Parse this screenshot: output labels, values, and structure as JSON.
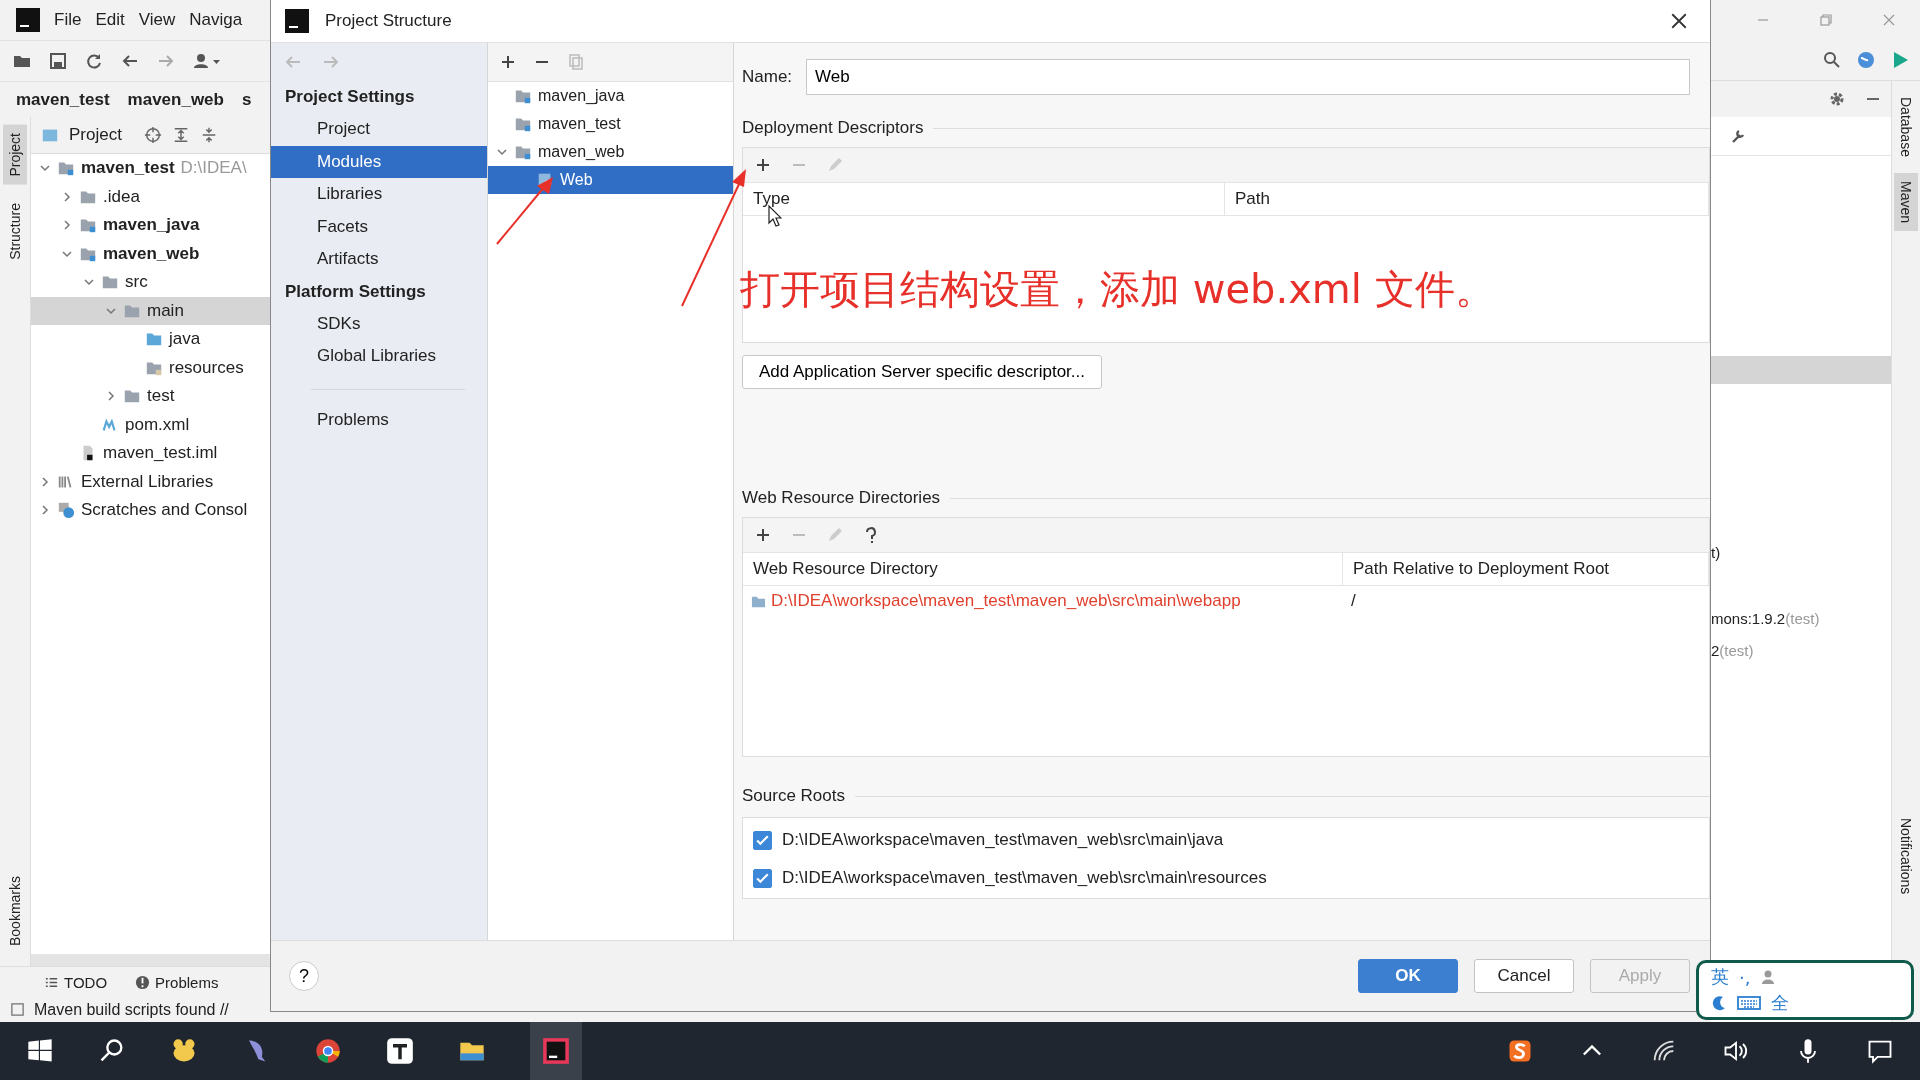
{
  "ide": {
    "menu": [
      "File",
      "Edit",
      "View",
      "Naviga"
    ],
    "breadcrumb": [
      "maven_test",
      "maven_web",
      "s"
    ],
    "panel_title": "Project",
    "tree": [
      {
        "label": "maven_test",
        "note": "D:\\IDEA\\",
        "kind": "module",
        "bold": true,
        "expanded": true,
        "selected": false,
        "children": [
          {
            "label": ".idea",
            "kind": "folder",
            "bold": false,
            "expanded": false,
            "selected": false
          },
          {
            "label": "maven_java",
            "kind": "module",
            "bold": true,
            "expanded": false,
            "selected": false
          },
          {
            "label": "maven_web",
            "kind": "module",
            "bold": true,
            "expanded": true,
            "selected": false,
            "children": [
              {
                "label": "src",
                "kind": "folder",
                "bold": false,
                "expanded": true,
                "selected": false,
                "children": [
                  {
                    "label": "main",
                    "kind": "folder",
                    "bold": false,
                    "expanded": true,
                    "selected": true,
                    "children": [
                      {
                        "label": "java",
                        "kind": "source",
                        "bold": false,
                        "selected": false
                      },
                      {
                        "label": "resources",
                        "kind": "resources",
                        "bold": false,
                        "selected": false
                      }
                    ]
                  },
                  {
                    "label": "test",
                    "kind": "folder",
                    "bold": false,
                    "expanded": false,
                    "selected": false
                  }
                ]
              },
              {
                "label": "pom.xml",
                "kind": "maven",
                "bold": false,
                "selected": false
              }
            ]
          },
          {
            "label": "maven_test.iml",
            "kind": "iml",
            "bold": false,
            "selected": false
          }
        ]
      },
      {
        "label": "External Libraries",
        "kind": "libraries",
        "bold": false,
        "expanded": false,
        "selected": false
      },
      {
        "label": "Scratches and Consol",
        "kind": "scratches",
        "bold": false,
        "expanded": false,
        "selected": false
      }
    ],
    "left_tabs": [
      {
        "label": "Project",
        "selected": true
      },
      {
        "label": "Structure",
        "selected": false
      }
    ],
    "bookmarks_tab": "Bookmarks",
    "bottom_tabs": [
      "TODO",
      "Problems"
    ],
    "status": "Maven build scripts found //",
    "right_lines": [
      {
        "text": "t)"
      },
      {
        "text": "mons:1.9.2",
        "note": "(test)"
      },
      {
        "text": "2",
        "note": "(test)"
      }
    ],
    "side_tabs": [
      {
        "label": "Database",
        "selected": false
      },
      {
        "label": "Maven",
        "selected": true
      }
    ],
    "notifications_tab": "Notifications"
  },
  "dialog": {
    "title": "Project Structure",
    "nav": [
      {
        "kind": "header",
        "label": "Project Settings"
      },
      {
        "kind": "item",
        "label": "Project",
        "selected": false
      },
      {
        "kind": "item",
        "label": "Modules",
        "selected": true
      },
      {
        "kind": "item",
        "label": "Libraries",
        "selected": false
      },
      {
        "kind": "item",
        "label": "Facets",
        "selected": false
      },
      {
        "kind": "item",
        "label": "Artifacts",
        "selected": false
      },
      {
        "kind": "header",
        "label": "Platform Settings"
      },
      {
        "kind": "item",
        "label": "SDKs",
        "selected": false
      },
      {
        "kind": "item",
        "label": "Global Libraries",
        "selected": false
      },
      {
        "kind": "separator"
      },
      {
        "kind": "item",
        "label": "Problems",
        "selected": false
      }
    ],
    "modules": [
      {
        "label": "maven_java",
        "kind": "module",
        "selected": false
      },
      {
        "label": "maven_test",
        "kind": "module",
        "selected": false
      },
      {
        "label": "maven_web",
        "kind": "module",
        "expanded": true,
        "selected": false,
        "children": [
          {
            "label": "Web",
            "kind": "facet",
            "selected": true
          }
        ]
      }
    ],
    "name_label": "Name:",
    "name_value": "Web",
    "deployment": {
      "title": "Deployment Descriptors",
      "columns": [
        "Type",
        "Path"
      ]
    },
    "server_button": "Add Application Server specific descriptor...",
    "web_resources": {
      "title": "Web Resource Directories",
      "columns": [
        "Web Resource Directory",
        "Path Relative to Deployment Root"
      ],
      "rows": [
        {
          "directory": "D:\\IDEA\\workspace\\maven_test\\maven_web\\src\\main\\webapp",
          "path": "/",
          "missing": true
        }
      ]
    },
    "source_roots": {
      "title": "Source Roots",
      "items": [
        {
          "path": "D:\\IDEA\\workspace\\maven_test\\maven_web\\src\\main\\java",
          "checked": true
        },
        {
          "path": "D:\\IDEA\\workspace\\maven_test\\maven_web\\src\\main\\resources",
          "checked": true
        }
      ]
    },
    "help": "?",
    "buttons": [
      {
        "label": "OK",
        "kind": "primary"
      },
      {
        "label": "Cancel",
        "kind": "normal"
      },
      {
        "label": "Apply",
        "kind": "disabled"
      }
    ]
  },
  "annotation": "打开项目结构设置，添加 web.xml 文件。",
  "ime": {
    "mode": "英",
    "punct": "·,",
    "width": "全"
  }
}
